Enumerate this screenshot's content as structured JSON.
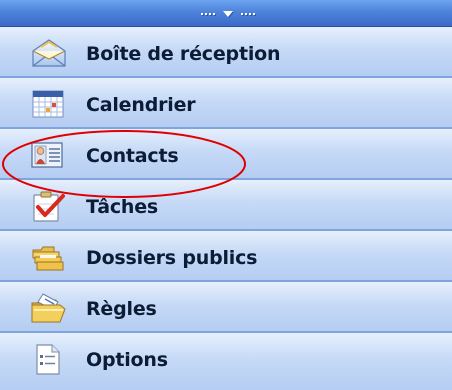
{
  "nav": {
    "items": [
      {
        "label": "Boîte de réception",
        "icon": "inbox-envelope-icon"
      },
      {
        "label": "Calendrier",
        "icon": "calendar-icon"
      },
      {
        "label": "Contacts",
        "icon": "contact-card-icon"
      },
      {
        "label": "Tâches",
        "icon": "tasks-clipboard-icon"
      },
      {
        "label": "Dossiers publics",
        "icon": "public-folders-icon"
      },
      {
        "label": "Règles",
        "icon": "rules-folder-icon"
      },
      {
        "label": "Options",
        "icon": "options-document-icon"
      }
    ],
    "selected_label": "Contacts",
    "annotation_color": "#e00000",
    "bar_color": "#4e83db",
    "item_color": "#c6daf7"
  }
}
